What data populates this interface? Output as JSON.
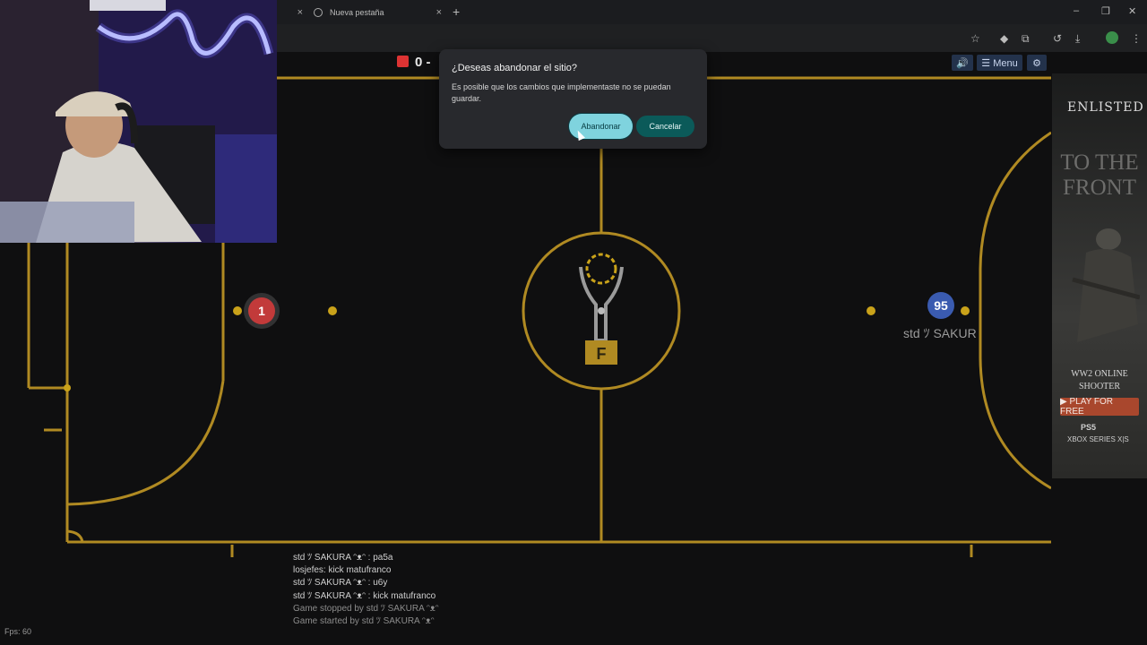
{
  "browser": {
    "tabs": [
      {
        "label": "",
        "close": "×"
      },
      {
        "label": "Nueva pestaña",
        "close": "×"
      }
    ],
    "new_tab": "+",
    "window_controls": {
      "minimize": "–",
      "restore": "❐",
      "close": "✕"
    },
    "toolbar_icons": [
      "star-icon",
      "extension-pin-icon",
      "puzzle-icon",
      "history-icon",
      "download-icon",
      "profile-icon",
      "kebab-menu-icon"
    ]
  },
  "game": {
    "score_left": "0 -",
    "mute_label": "🔊",
    "menu_label": "☰ Menu",
    "settings_label": "⚙",
    "red_player_number": "1",
    "blue_player_number": "95",
    "blue_player_name": "std ﾂ SAKUR",
    "center_logo_letter": "F",
    "field_line_color": "#b08a22",
    "fps": "Fps: 60"
  },
  "chat": {
    "messages": [
      {
        "text": "std ﾂ SAKURA ᵔᴥᵔ : pa5a",
        "color": "#cfcfcf"
      },
      {
        "text": "losjefes: kick matufranco",
        "color": "#cfcfcf"
      },
      {
        "text": "std ﾂ SAKURA ᵔᴥᵔ : u6y",
        "color": "#cfcfcf"
      },
      {
        "text": "std ﾂ SAKURA ᵔᴥᵔ : kick matufranco",
        "color": "#cfcfcf"
      },
      {
        "text": "Game stopped by std ﾂ SAKURA ᵔᴥᵔ",
        "color": "#8c8c8c"
      },
      {
        "text": "Game started by std ﾂ SAKURA ᵔᴥᵔ",
        "color": "#8c8c8c"
      }
    ]
  },
  "dialog": {
    "title": "¿Deseas abandonar el sitio?",
    "body": "Es posible que los cambios que implementaste no se puedan guardar.",
    "leave_label": "Abandonar",
    "cancel_label": "Cancelar",
    "accent_color": "#7fd3de"
  },
  "ad": {
    "logo": "ENLISTED",
    "headline_line1": "TO THE",
    "headline_line2": "FRONT",
    "sub": "WW2 ONLINE SHOOTER",
    "cta": "▶ PLAY FOR FREE",
    "platform1": "PS5",
    "platform2": "XBOX SERIES X|S"
  }
}
